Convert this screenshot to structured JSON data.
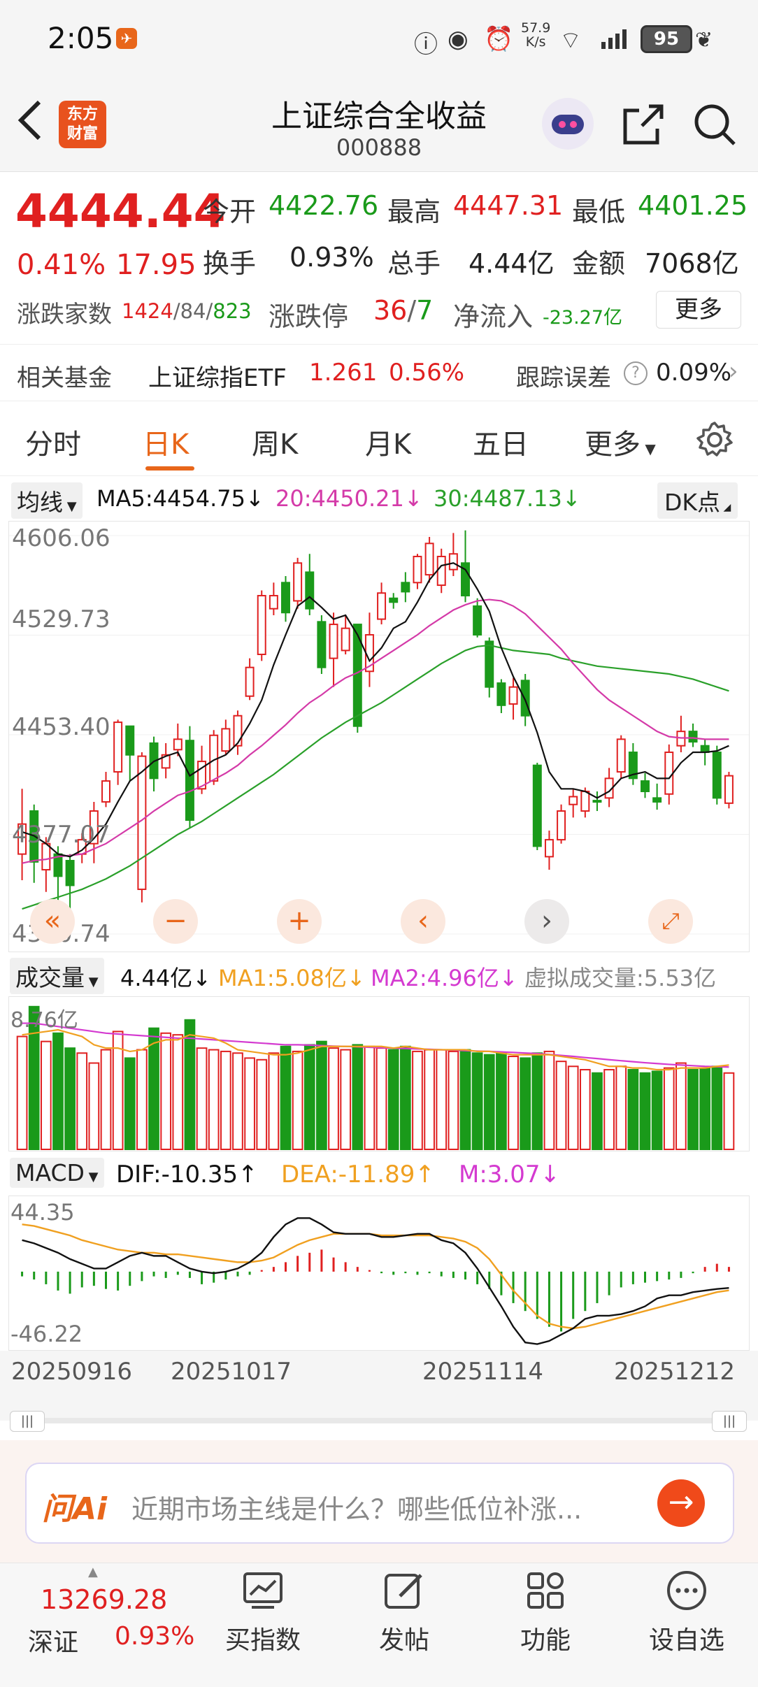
{
  "status": {
    "time": "2:05",
    "net_speed_top": "57.9",
    "net_speed_bottom": "K/s",
    "signal": "6",
    "battery": "95"
  },
  "header": {
    "logo_line1": "东方",
    "logo_line2": "财富",
    "title": "上证综合全收益",
    "code": "000888"
  },
  "quote": {
    "price": "4444.44",
    "change_pct": "0.41%",
    "change": "17.95",
    "open_label": "今开",
    "open": "4422.76",
    "high_label": "最高",
    "high": "4447.31",
    "low_label": "最低",
    "low": "4401.25",
    "turnover_label": "换手",
    "turnover": "0.93%",
    "volume_label": "总手",
    "volume": "4.44亿",
    "amount_label": "金额",
    "amount": "7068亿",
    "updown_label": "涨跌家数",
    "up": "1424",
    "flat": "84",
    "down": "823",
    "limit_label": "涨跌停",
    "limit_up": "36",
    "limit_down": "7",
    "netflow_label": "净流入",
    "netflow": "-23.27亿",
    "more_button": "更多"
  },
  "fund": {
    "label": "相关基金",
    "name": "上证综指ETF",
    "price": "1.261",
    "pct": "0.56%",
    "track_label": "跟踪误差",
    "track_value": "0.09%"
  },
  "tabs": [
    "分时",
    "日K",
    "周K",
    "月K",
    "五日",
    "更多"
  ],
  "ma_bar": {
    "select": "均线",
    "ma5": "MA5:4454.75",
    "ma20": "20:4450.21",
    "ma30": "30:4487.13",
    "dk": "DK点"
  },
  "kline": {
    "y_labels": [
      "4606.06",
      "4529.73",
      "4453.40",
      "4377.07",
      "4300.74"
    ],
    "y_values": [
      4606.06,
      4529.73,
      4453.4,
      4377.07,
      4300.74
    ]
  },
  "vol_bar": {
    "select": "成交量",
    "value": "4.44亿",
    "ma1": "MA1:5.08亿",
    "ma2": "MA2:4.96亿",
    "virtual": "虚拟成交量:5.53亿",
    "y_max": "8.76亿"
  },
  "macd_bar": {
    "select": "MACD",
    "dif": "DIF:-10.35",
    "dea": "DEA:-11.89",
    "m": "M:3.07",
    "y_top": "44.35",
    "y_bottom": "-46.22"
  },
  "dates": [
    "20250916",
    "20251017",
    "20251114",
    "20251212"
  ],
  "ai": {
    "logo": "问Ai",
    "placeholder": "近期市场主线是什么？哪些低位补涨..."
  },
  "bottom": {
    "index_value": "13269.28",
    "index_name": "深证",
    "index_pct": "0.93%",
    "items": [
      "买指数",
      "发帖",
      "功能",
      "设自选"
    ]
  },
  "colors": {
    "up": "#e02020",
    "down": "#1a9a1a",
    "accent": "#e8661a",
    "ma5": "#111111",
    "ma20": "#d43aa8",
    "ma30": "#2aa02a",
    "ma1": "#f0a020",
    "ma2": "#d43ad0"
  },
  "chart_data": {
    "type": "candlestick",
    "ylim": [
      4300.74,
      4606.06
    ],
    "x_ticks": [
      "20250916",
      "20251017",
      "20251114",
      "20251212"
    ],
    "candles": [
      [
        4362,
        4385,
        4342,
        4412
      ],
      [
        4395,
        4356,
        4340,
        4400
      ],
      [
        4350,
        4370,
        4333,
        4375
      ],
      [
        4362,
        4345,
        4325,
        4368
      ],
      [
        4357,
        4338,
        4310,
        4362
      ],
      [
        4362,
        4373,
        4355,
        4378
      ],
      [
        4370,
        4395,
        4355,
        4402
      ],
      [
        4402,
        4418,
        4398,
        4425
      ],
      [
        4425,
        4463,
        4415,
        4465
      ],
      [
        4460,
        4438,
        4418,
        4460
      ],
      [
        4335,
        4437,
        4325,
        4440
      ],
      [
        4447,
        4420,
        4410,
        4452
      ],
      [
        4428,
        4438,
        4420,
        4447
      ],
      [
        4442,
        4450,
        4437,
        4462
      ],
      [
        4449,
        4388,
        4382,
        4460
      ],
      [
        4412,
        4433,
        4408,
        4445
      ],
      [
        4418,
        4453,
        4415,
        4457
      ],
      [
        4441,
        4458,
        4438,
        4465
      ],
      [
        4445,
        4468,
        4438,
        4472
      ],
      [
        4483,
        4505,
        4480,
        4512
      ],
      [
        4515,
        4560,
        4510,
        4564
      ],
      [
        4550,
        4560,
        4545,
        4570
      ],
      [
        4570,
        4547,
        4540,
        4575
      ],
      [
        4556,
        4585,
        4550,
        4589
      ],
      [
        4578,
        4550,
        4545,
        4592
      ],
      [
        4540,
        4505,
        4500,
        4545
      ],
      [
        4512,
        4538,
        4490,
        4547
      ],
      [
        4518,
        4535,
        4515,
        4545
      ],
      [
        4538,
        4460,
        4455,
        4530
      ],
      [
        4502,
        4530,
        4490,
        4547
      ],
      [
        4542,
        4562,
        4538,
        4570
      ],
      [
        4558,
        4555,
        4550,
        4562
      ],
      [
        4570,
        4563,
        4555,
        4578
      ],
      [
        4570,
        4590,
        4565,
        4592
      ],
      [
        4576,
        4600,
        4570,
        4605
      ],
      [
        4568,
        4590,
        4562,
        4596
      ],
      [
        4580,
        4592,
        4575,
        4608
      ],
      [
        4585,
        4560,
        4555,
        4610
      ],
      [
        4552,
        4530,
        4528,
        4558
      ],
      [
        4525,
        4490,
        4482,
        4528
      ],
      [
        4493,
        4476,
        4470,
        4496
      ],
      [
        4477,
        4490,
        4465,
        4497
      ],
      [
        4495,
        4468,
        4460,
        4500
      ],
      [
        4430,
        4368,
        4365,
        4432
      ],
      [
        4360,
        4373,
        4350,
        4380
      ],
      [
        4373,
        4395,
        4370,
        4400
      ],
      [
        4400,
        4406,
        4390,
        4412
      ],
      [
        4395,
        4410,
        4390,
        4413
      ],
      [
        4403,
        4402,
        4395,
        4410
      ],
      [
        4405,
        4420,
        4398,
        4428
      ],
      [
        4425,
        4450,
        4420,
        4453
      ],
      [
        4440,
        4420,
        4415,
        4447
      ],
      [
        4418,
        4410,
        4405,
        4424
      ],
      [
        4405,
        4402,
        4396,
        4416
      ],
      [
        4408,
        4440,
        4400,
        4446
      ],
      [
        4445,
        4456,
        4440,
        4468
      ],
      [
        4456,
        4448,
        4444,
        4462
      ],
      [
        4445,
        4440,
        4430,
        4450
      ],
      [
        4440,
        4405,
        4400,
        4445
      ],
      [
        4401,
        4422,
        4397,
        4425
      ]
    ],
    "ma5": [
      4379,
      4376,
      4370,
      4362,
      4360,
      4365,
      4374,
      4385,
      4402,
      4418,
      4425,
      4433,
      4437,
      4440,
      4422,
      4428,
      4434,
      4438,
      4447,
      4462,
      4480,
      4507,
      4530,
      4552,
      4559,
      4551,
      4542,
      4545,
      4530,
      4510,
      4520,
      4535,
      4540,
      4555,
      4572,
      4583,
      4585,
      4580,
      4565,
      4548,
      4520,
      4498,
      4480,
      4455,
      4425,
      4412,
      4412,
      4410,
      4405,
      4410,
      4420,
      4423,
      4425,
      4420,
      4420,
      4432,
      4440,
      4440,
      4441,
      4445
    ],
    "ma20": [
      4355,
      4357,
      4358,
      4360,
      4361,
      4362,
      4366,
      4370,
      4376,
      4382,
      4388,
      4395,
      4401,
      4407,
      4410,
      4414,
      4419,
      4424,
      4430,
      4438,
      4445,
      4453,
      4461,
      4470,
      4478,
      4484,
      4491,
      4497,
      4501,
      4506,
      4512,
      4518,
      4524,
      4530,
      4537,
      4543,
      4549,
      4553,
      4556,
      4557,
      4556,
      4552,
      4546,
      4537,
      4528,
      4519,
      4508,
      4498,
      4488,
      4480,
      4474,
      4468,
      4462,
      4456,
      4452,
      4451,
      4451,
      4450,
      4450,
      4450
    ],
    "ma30": [
      4320,
      4323,
      4326,
      4329,
      4332,
      4335,
      4339,
      4343,
      4348,
      4353,
      4359,
      4365,
      4371,
      4377,
      4382,
      4387,
      4393,
      4399,
      4405,
      4411,
      4417,
      4423,
      4430,
      4437,
      4444,
      4451,
      4457,
      4463,
      4468,
      4473,
      4478,
      4484,
      4490,
      4496,
      4502,
      4508,
      4513,
      4518,
      4521,
      4522,
      4520,
      4518,
      4517,
      4516,
      4515,
      4512,
      4510,
      4508,
      4506,
      4505,
      4504,
      4503,
      4502,
      4501,
      4500,
      4498,
      4496,
      4493,
      4490,
      4487
    ]
  },
  "volume_data": {
    "ymax": 8.76,
    "values": [
      6.8,
      8.6,
      6.5,
      7.0,
      6.1,
      5.8,
      5.2,
      6.0,
      7.1,
      5.5,
      6.0,
      7.3,
      7.0,
      6.9,
      7.8,
      6.1,
      6.0,
      5.9,
      5.8,
      5.5,
      5.4,
      5.8,
      6.2,
      5.9,
      6.3,
      6.5,
      6.1,
      6.0,
      6.3,
      6.2,
      6.1,
      6.0,
      6.2,
      5.9,
      6.0,
      6.0,
      5.9,
      6.0,
      5.8,
      5.7,
      5.8,
      5.6,
      5.5,
      5.8,
      5.9,
      5.3,
      5.0,
      4.8,
      4.6,
      4.8,
      5.0,
      4.8,
      4.6,
      4.7,
      4.9,
      5.2,
      4.8,
      4.9,
      5.0,
      4.6
    ],
    "ma1": [
      6.9,
      7.0,
      7.1,
      7.2,
      7.0,
      6.8,
      6.3,
      6.1,
      6.1,
      5.9,
      6.0,
      6.4,
      6.6,
      6.6,
      6.9,
      6.8,
      6.7,
      6.4,
      6.0,
      5.9,
      5.8,
      5.7,
      5.7,
      5.8,
      6.0,
      6.2,
      6.2,
      6.2,
      6.2,
      6.2,
      6.2,
      6.1,
      6.2,
      6.1,
      6.0,
      6.0,
      6.0,
      6.0,
      5.9,
      5.9,
      5.8,
      5.7,
      5.7,
      5.7,
      5.7,
      5.6,
      5.5,
      5.4,
      5.2,
      5.0,
      5.0,
      4.9,
      4.9,
      4.8,
      4.8,
      4.9,
      4.9,
      4.9,
      5.0,
      5.08
    ],
    "ma2": [
      7.6,
      7.6,
      7.5,
      7.4,
      7.3,
      7.2,
      7.1,
      7.0,
      6.95,
      6.9,
      6.85,
      6.8,
      6.75,
      6.7,
      6.7,
      6.65,
      6.6,
      6.55,
      6.5,
      6.45,
      6.4,
      6.35,
      6.3,
      6.3,
      6.28,
      6.25,
      6.22,
      6.2,
      6.18,
      6.15,
      6.12,
      6.1,
      6.08,
      6.05,
      6.03,
      6.0,
      5.98,
      5.95,
      5.92,
      5.9,
      5.87,
      5.84,
      5.8,
      5.77,
      5.72,
      5.66,
      5.6,
      5.53,
      5.47,
      5.4,
      5.34,
      5.28,
      5.22,
      5.17,
      5.12,
      5.08,
      5.04,
      5.0,
      4.98,
      4.96
    ]
  },
  "macd_data": {
    "ymin": -46.22,
    "ymax": 44.35,
    "hist": [
      -3,
      -5,
      -8,
      -12,
      -14,
      -10,
      -9,
      -11,
      -12,
      -9,
      -6,
      -3,
      -4,
      -2,
      -4,
      -8,
      -7,
      -5,
      -3,
      -2,
      1,
      3,
      6,
      10,
      12,
      14,
      9,
      6,
      3,
      1,
      -1,
      -2,
      -1,
      -2,
      -1,
      -3,
      -4,
      -5,
      -8,
      -11,
      -15,
      -20,
      -25,
      -30,
      -35,
      -38,
      -30,
      -25,
      -20,
      -15,
      -10,
      -8,
      -7,
      -6,
      -5,
      -4,
      -1,
      3,
      5,
      3
    ],
    "dif": [
      20,
      18,
      15,
      12,
      8,
      5,
      2,
      2,
      6,
      10,
      12,
      10,
      10,
      6,
      2,
      0,
      -1,
      0,
      2,
      6,
      12,
      22,
      30,
      34,
      34,
      30,
      25,
      24,
      24,
      24,
      22,
      22,
      23,
      24,
      24,
      20,
      18,
      12,
      2,
      -10,
      -22,
      -35,
      -45,
      -46,
      -44,
      -40,
      -36,
      -30,
      -28,
      -28,
      -27,
      -25,
      -22,
      -17,
      -15,
      -15,
      -13,
      -12,
      -11,
      -10.35
    ],
    "dea": [
      30,
      29,
      27,
      25,
      23,
      20,
      18,
      16,
      14,
      13,
      12,
      12,
      11,
      11,
      10,
      9,
      8,
      7,
      6,
      6,
      7,
      9,
      13,
      17,
      20,
      22,
      24,
      24,
      24,
      24,
      23,
      23,
      23,
      23,
      23,
      22,
      21,
      19,
      15,
      8,
      -2,
      -12,
      -20,
      -28,
      -33,
      -35,
      -36,
      -35,
      -33,
      -31,
      -29,
      -27,
      -25,
      -23,
      -21,
      -19,
      -17,
      -15,
      -13,
      -11.89
    ]
  }
}
